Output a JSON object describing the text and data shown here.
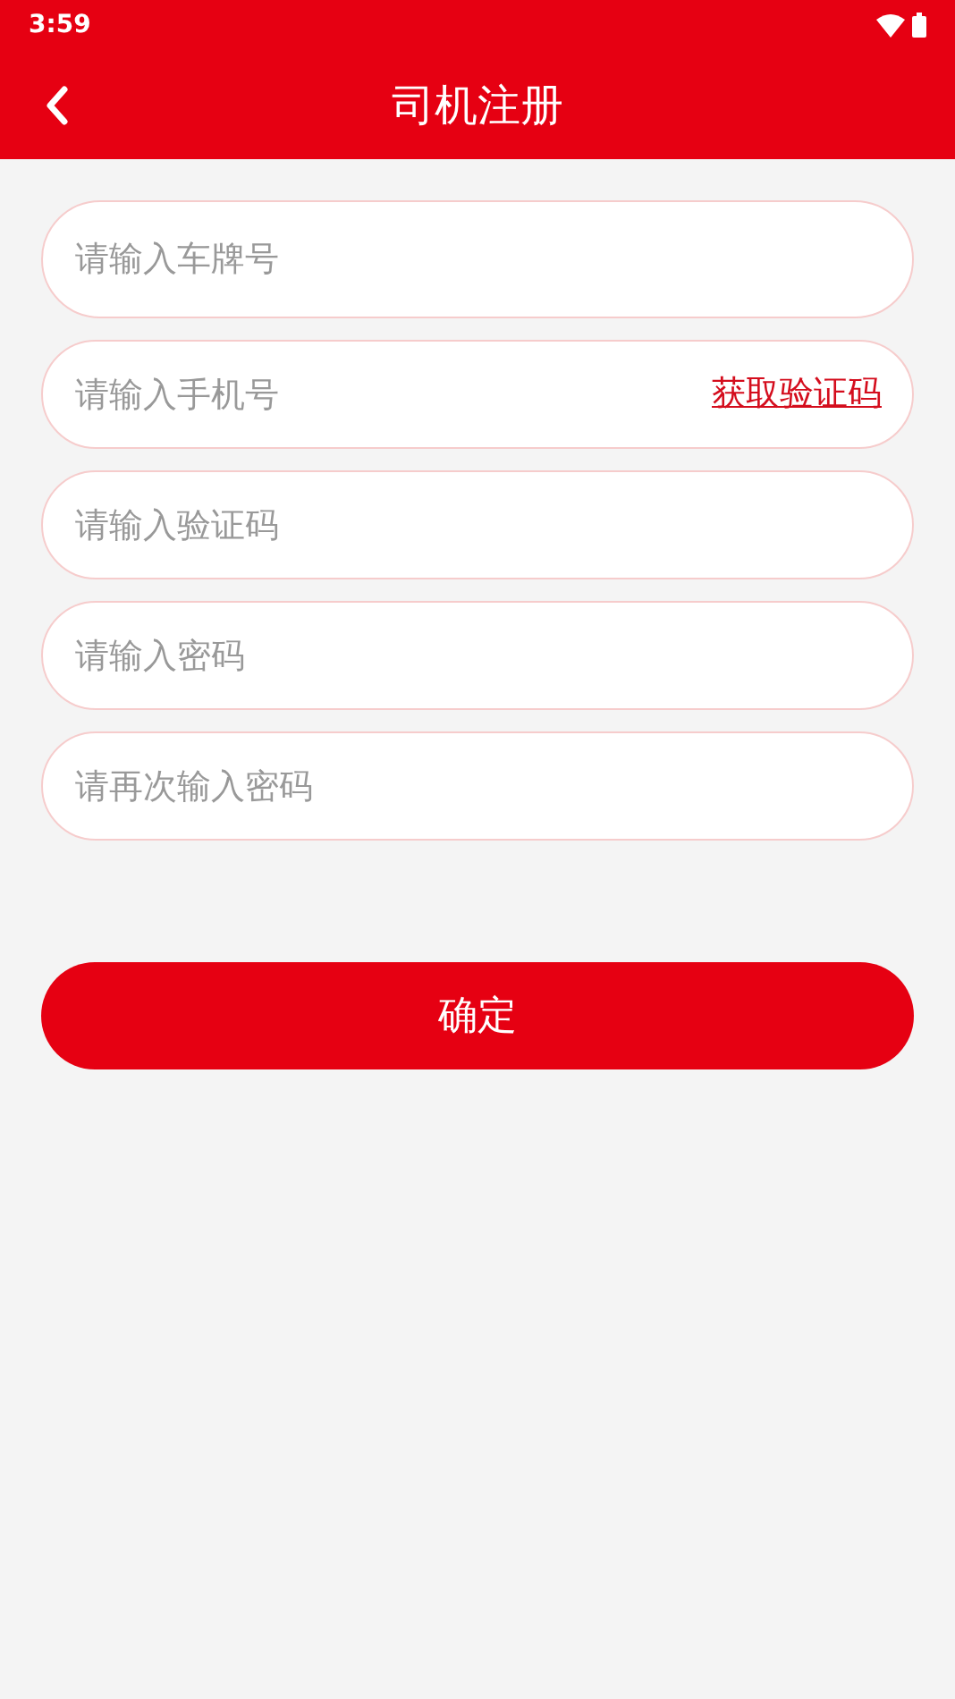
{
  "status_bar": {
    "time": "3:59"
  },
  "header": {
    "title": "司机注册"
  },
  "fields": [
    {
      "placeholder": "请输入车牌号"
    },
    {
      "placeholder": "请输入手机号",
      "action": "获取验证码"
    },
    {
      "placeholder": "请输入验证码"
    },
    {
      "placeholder": "请输入密码"
    },
    {
      "placeholder": "请再次输入密码"
    }
  ],
  "submit": "确定"
}
